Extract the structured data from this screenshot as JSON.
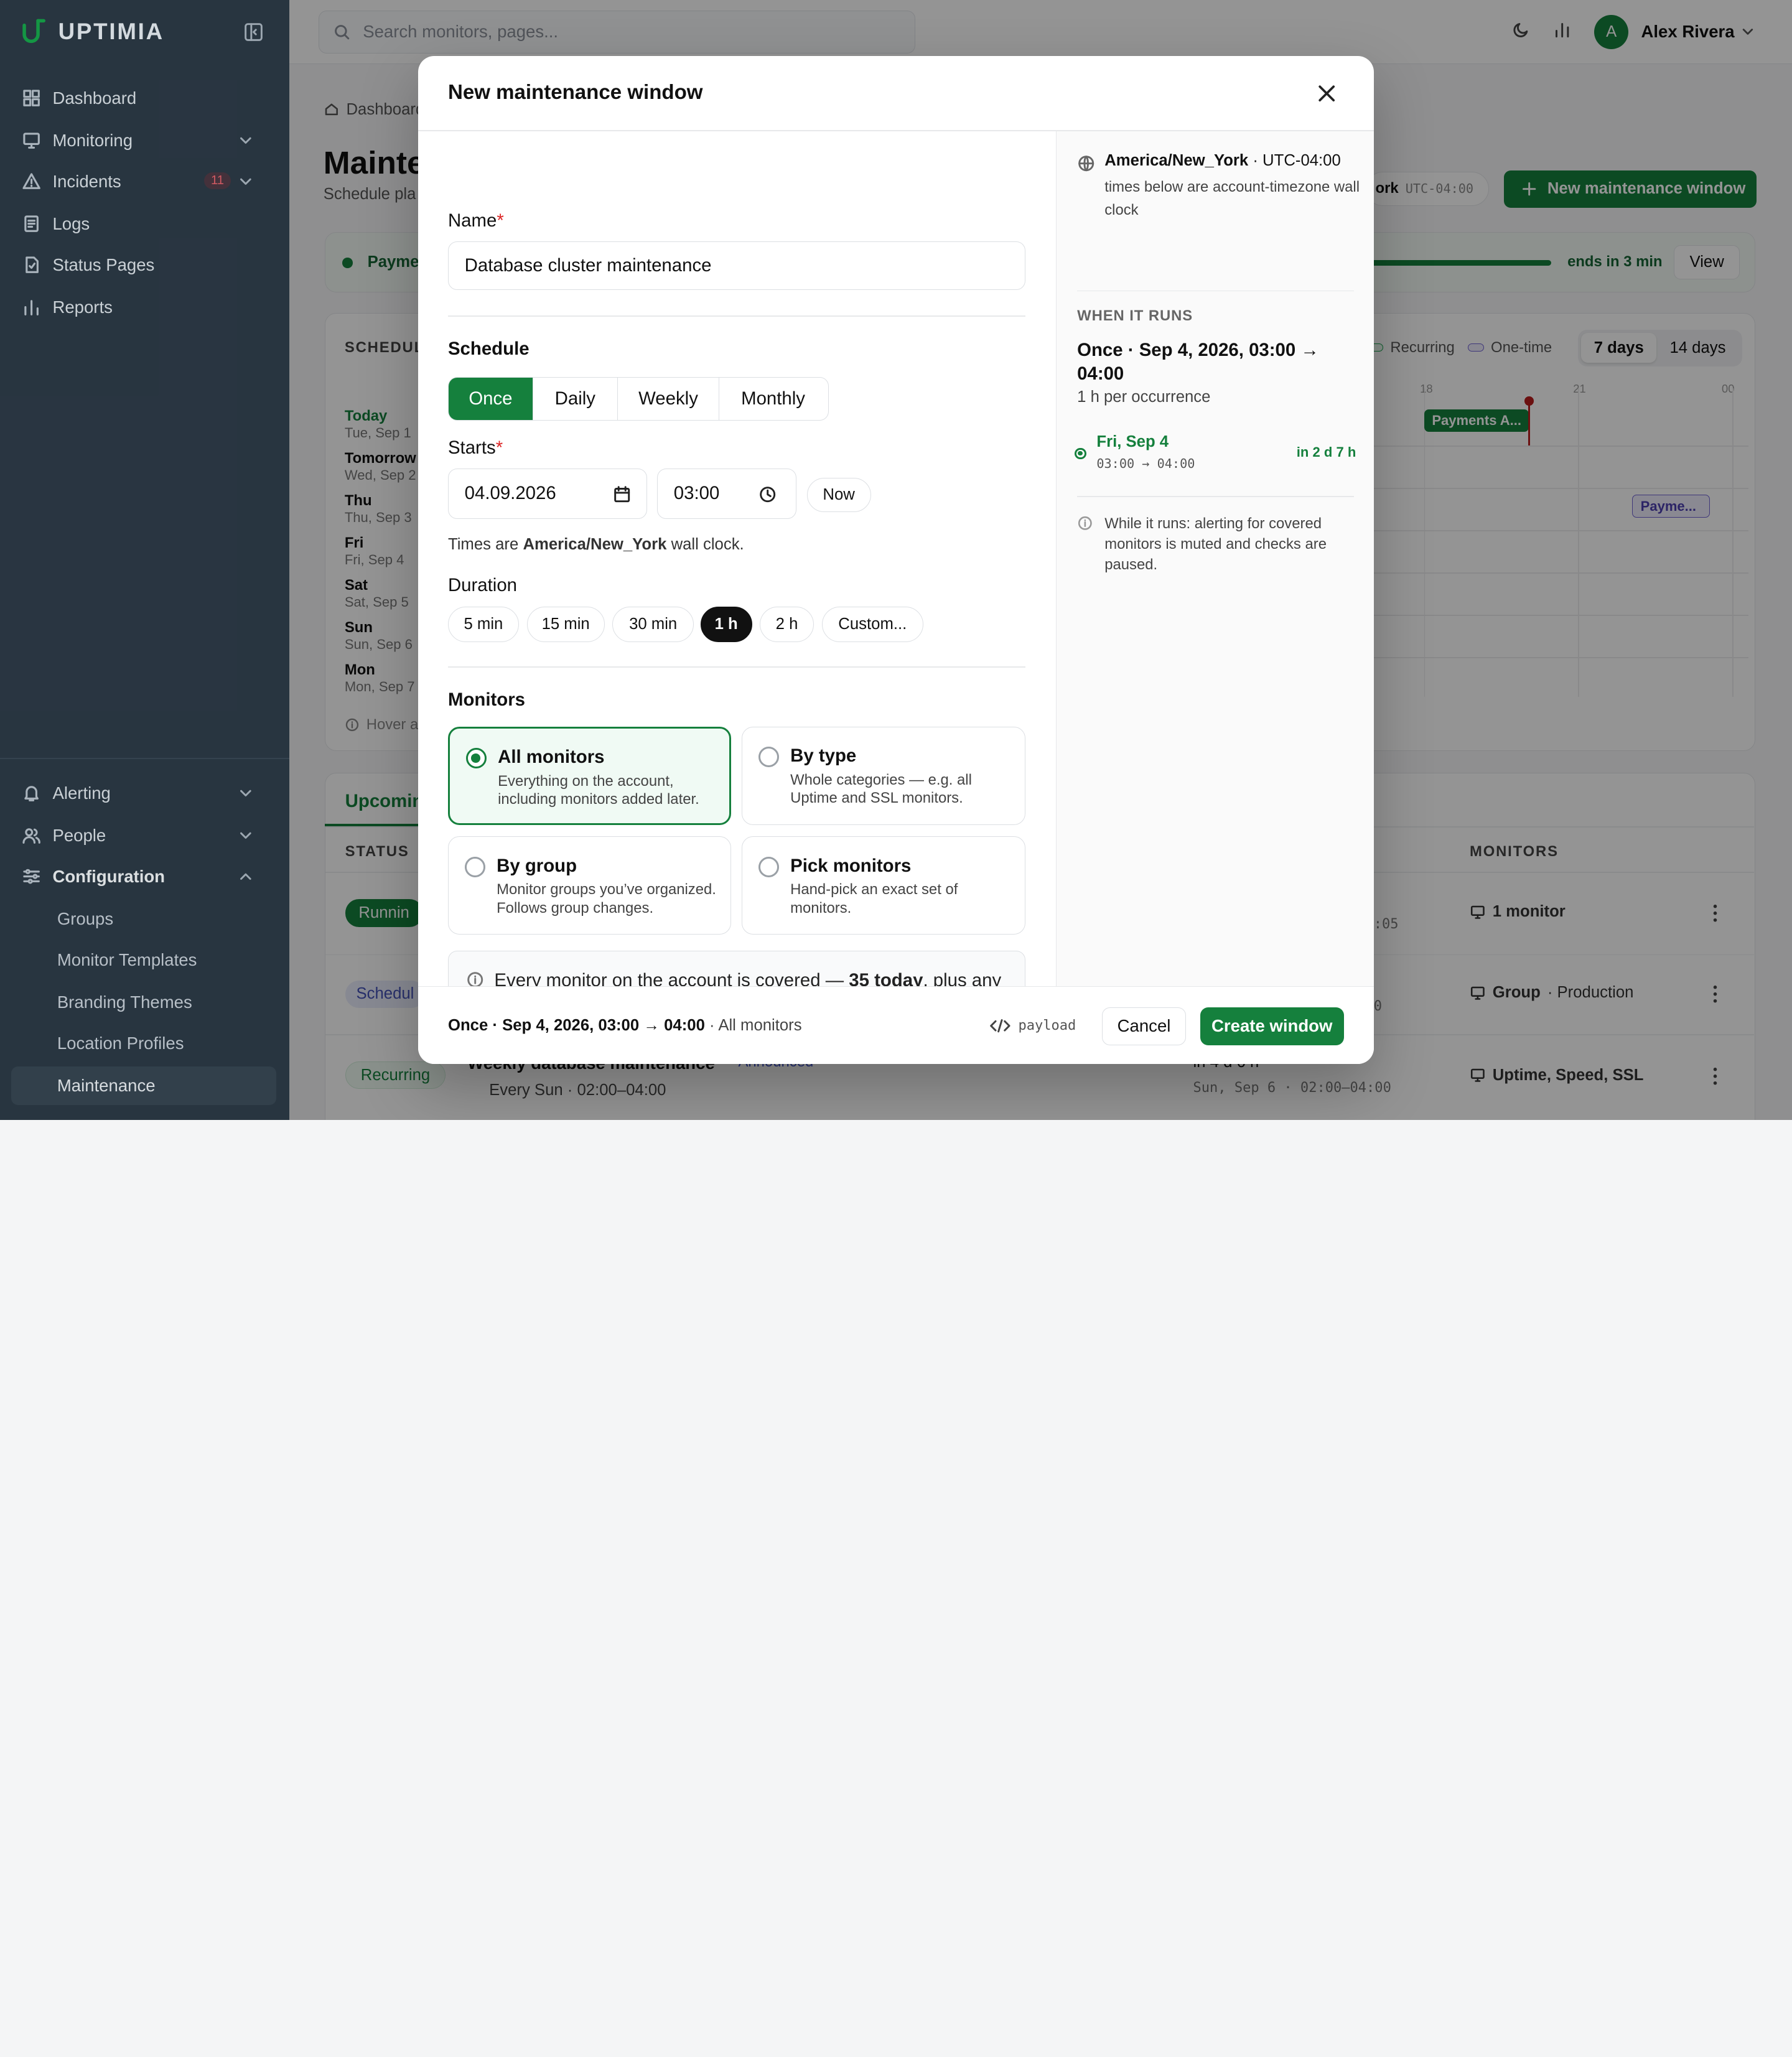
{
  "app": {
    "name": "UPTIMIA"
  },
  "sidebar": {
    "items": [
      {
        "label": "Dashboard",
        "icon": "dashboard-icon"
      },
      {
        "label": "Monitoring",
        "icon": "monitor-icon"
      },
      {
        "label": "Incidents",
        "icon": "alert-triangle-icon",
        "badge": "11"
      },
      {
        "label": "Logs",
        "icon": "logs-icon"
      },
      {
        "label": "Status Pages",
        "icon": "status-page-icon"
      },
      {
        "label": "Reports",
        "icon": "bar-chart-icon"
      }
    ],
    "bottom": [
      {
        "label": "Alerting",
        "icon": "bell-icon"
      },
      {
        "label": "People",
        "icon": "users-icon"
      },
      {
        "label": "Configuration",
        "icon": "sliders-icon"
      }
    ],
    "sub": [
      "Groups",
      "Monitor Templates",
      "Branding Themes",
      "Location Profiles",
      "Maintenance"
    ]
  },
  "topbar": {
    "search_placeholder": "Search monitors, pages...",
    "user_initial": "A",
    "user_name": "Alex Rivera"
  },
  "page": {
    "breadcrumb": "Dashboard",
    "title": "Mainte",
    "subtitle": "Schedule pla",
    "tz_frag": "ork",
    "tz_offset": "UTC-04:00",
    "new_button": "New maintenance window",
    "banner_name": "Payme",
    "banner_ends": "ends in 3 min",
    "banner_view": "View",
    "banner_progress": 0.9
  },
  "schedule": {
    "header": "SCHEDUL",
    "days": [
      {
        "name": "Today",
        "date": "Tue, Sep 1"
      },
      {
        "name": "Tomorrow",
        "date": "Wed, Sep 2"
      },
      {
        "name": "Thu",
        "date": "Thu, Sep 3"
      },
      {
        "name": "Fri",
        "date": "Fri, Sep 4"
      },
      {
        "name": "Sat",
        "date": "Sat, Sep 5"
      },
      {
        "name": "Sun",
        "date": "Sun, Sep 6"
      },
      {
        "name": "Mon",
        "date": "Mon, Sep 7"
      }
    ],
    "legend_recurring": "Recurring",
    "legend_onetime": "One-time",
    "range_7": "7 days",
    "range_14": "14 days",
    "tick_18": "18",
    "tick_21": "21",
    "tick_00": "00",
    "event_1": "Payments A...",
    "event_2": "Payme...",
    "hover_hint": "Hover a"
  },
  "table": {
    "tab": "Upcomin",
    "col_status": "STATUS",
    "col_monitors": "MONITORS",
    "rows": [
      {
        "status": "Runnin",
        "time_frag": ":05",
        "monitors": "1 monitor",
        "monitors_suffix": ""
      },
      {
        "status": "Schedul",
        "time_frag": "0",
        "monitors": "Group",
        "monitors_suffix": "· Production"
      },
      {
        "status": "Recurring",
        "name": "Weekly database maintenance",
        "tag": "Announced",
        "repeat": "Every Sun · 02:00–04:00",
        "in": "in 4 d 6 h",
        "window": "Sun, Sep 6 · 02:00–04:00",
        "monitors": "Uptime, Speed, SSL",
        "monitors_suffix": ""
      }
    ]
  },
  "modal": {
    "title": "New maintenance window",
    "name_label": "Name",
    "name_value": "Database cluster maintenance",
    "schedule_label": "Schedule",
    "schedule_tabs": [
      "Once",
      "Daily",
      "Weekly",
      "Monthly"
    ],
    "starts_label": "Starts",
    "date_value": "04.09.2026",
    "time_value": "03:00",
    "now_button": "Now",
    "tz_note_prefix": "Times are",
    "tz_note_zone": "America/New_York",
    "tz_note_suffix": "wall clock.",
    "duration_label": "Duration",
    "durations": [
      "5 min",
      "15 min",
      "30 min",
      "1 h",
      "2 h",
      "Custom..."
    ],
    "monitors_label": "Monitors",
    "options": [
      {
        "title": "All monitors",
        "desc": "Everything on the account, including monitors added later."
      },
      {
        "title": "By type",
        "desc": "Whole categories — e.g. all Uptime and SSL monitors."
      },
      {
        "title": "By group",
        "desc": "Monitor groups you’ve organized. Follows group changes."
      },
      {
        "title": "Pick monitors",
        "desc": "Hand-pick an exact set of monitors."
      }
    ],
    "info_prefix": "Every monitor on the account is covered —",
    "info_bold": "35 today",
    "info_suffix": ", plus any added while the window exists.",
    "right": {
      "tz_name": "America/New_York",
      "tz_offset": "· UTC-04:00",
      "tz_desc": "times below are account-timezone wall clock",
      "when_header": "WHEN IT RUNS",
      "when_summary": "Once · Sep 4, 2026, 03:00 → 04:00",
      "per_occurrence": "1 h per occurrence",
      "occ_day": "Fri, Sep 4",
      "occ_time": "03:00 → 04:00",
      "occ_in": "in 2 d 7 h",
      "note": "While it runs: alerting for covered monitors is muted and checks are paused."
    },
    "footer": {
      "summary": "Once · Sep 4, 2026, 03:00 → 04:00",
      "scope": "· All monitors",
      "payload": "payload",
      "cancel": "Cancel",
      "create": "Create window"
    }
  },
  "colors": {
    "accent": "#15803d",
    "sidebar": "#2c3a46",
    "danger": "#dc2626"
  }
}
